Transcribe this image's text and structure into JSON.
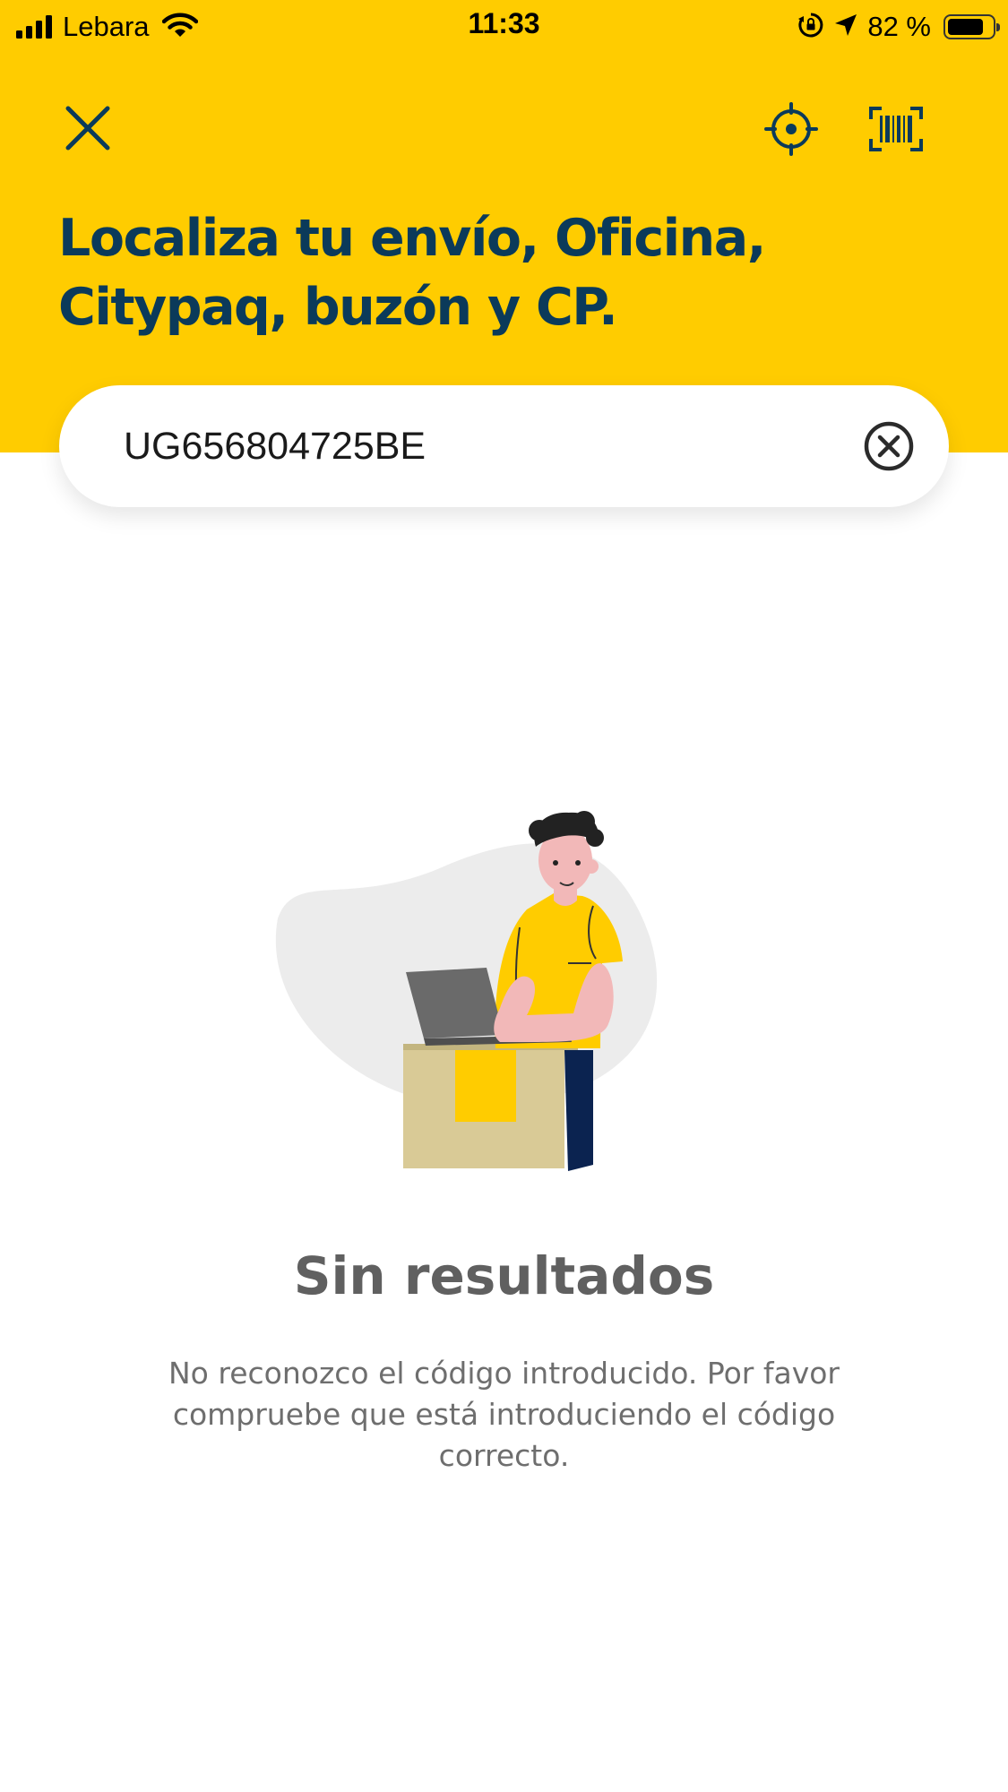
{
  "status_bar": {
    "carrier": "Lebara",
    "time": "11:33",
    "battery_percent_text": "82 %",
    "battery_level": 0.82,
    "icons": [
      "signal-icon",
      "wifi-icon",
      "orientation-lock-icon",
      "location-arrow-icon",
      "battery-icon"
    ]
  },
  "header": {
    "background_color": "#FFCC00",
    "title": "Localiza tu envío, Oficina, Citypaq, buzón y CP.",
    "actions": [
      "close-icon",
      "locate-icon",
      "barcode-scan-icon"
    ]
  },
  "search": {
    "value": "UG656804725BE",
    "clear_icon": "clear-icon"
  },
  "empty_state": {
    "title": "Sin resultados",
    "message": "No reconozco el código introducido. Por favor compruebe que está introduciendo el código correcto."
  },
  "colors": {
    "brand_yellow": "#FFCC00",
    "title_blue": "#0B3A5A",
    "gray_text": "#6e6e6e"
  }
}
